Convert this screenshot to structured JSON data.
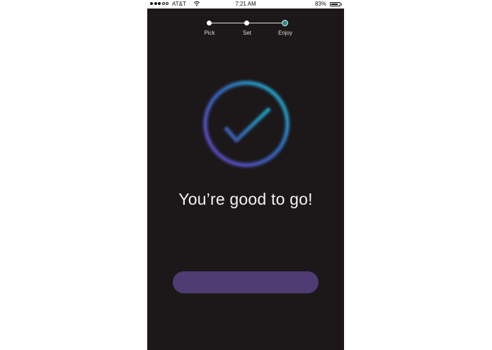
{
  "status_bar": {
    "carrier": "AT&T",
    "time": "7:21 AM",
    "battery_percent": "83%",
    "battery_level": 0.83,
    "signal_bars_filled": 3,
    "signal_bars_total": 5
  },
  "stepper": {
    "steps": [
      {
        "label": "Pick",
        "state": "done"
      },
      {
        "label": "Set",
        "state": "done"
      },
      {
        "label": "Enjoy",
        "state": "active"
      }
    ]
  },
  "hero": {
    "icon": "checkmark-circle-icon",
    "colors": {
      "purple": "#5b3aa6",
      "teal": "#1fa3b3"
    }
  },
  "main": {
    "headline": "You’re good to go!"
  },
  "cta": {
    "label": "",
    "color": "#4e3c73"
  }
}
